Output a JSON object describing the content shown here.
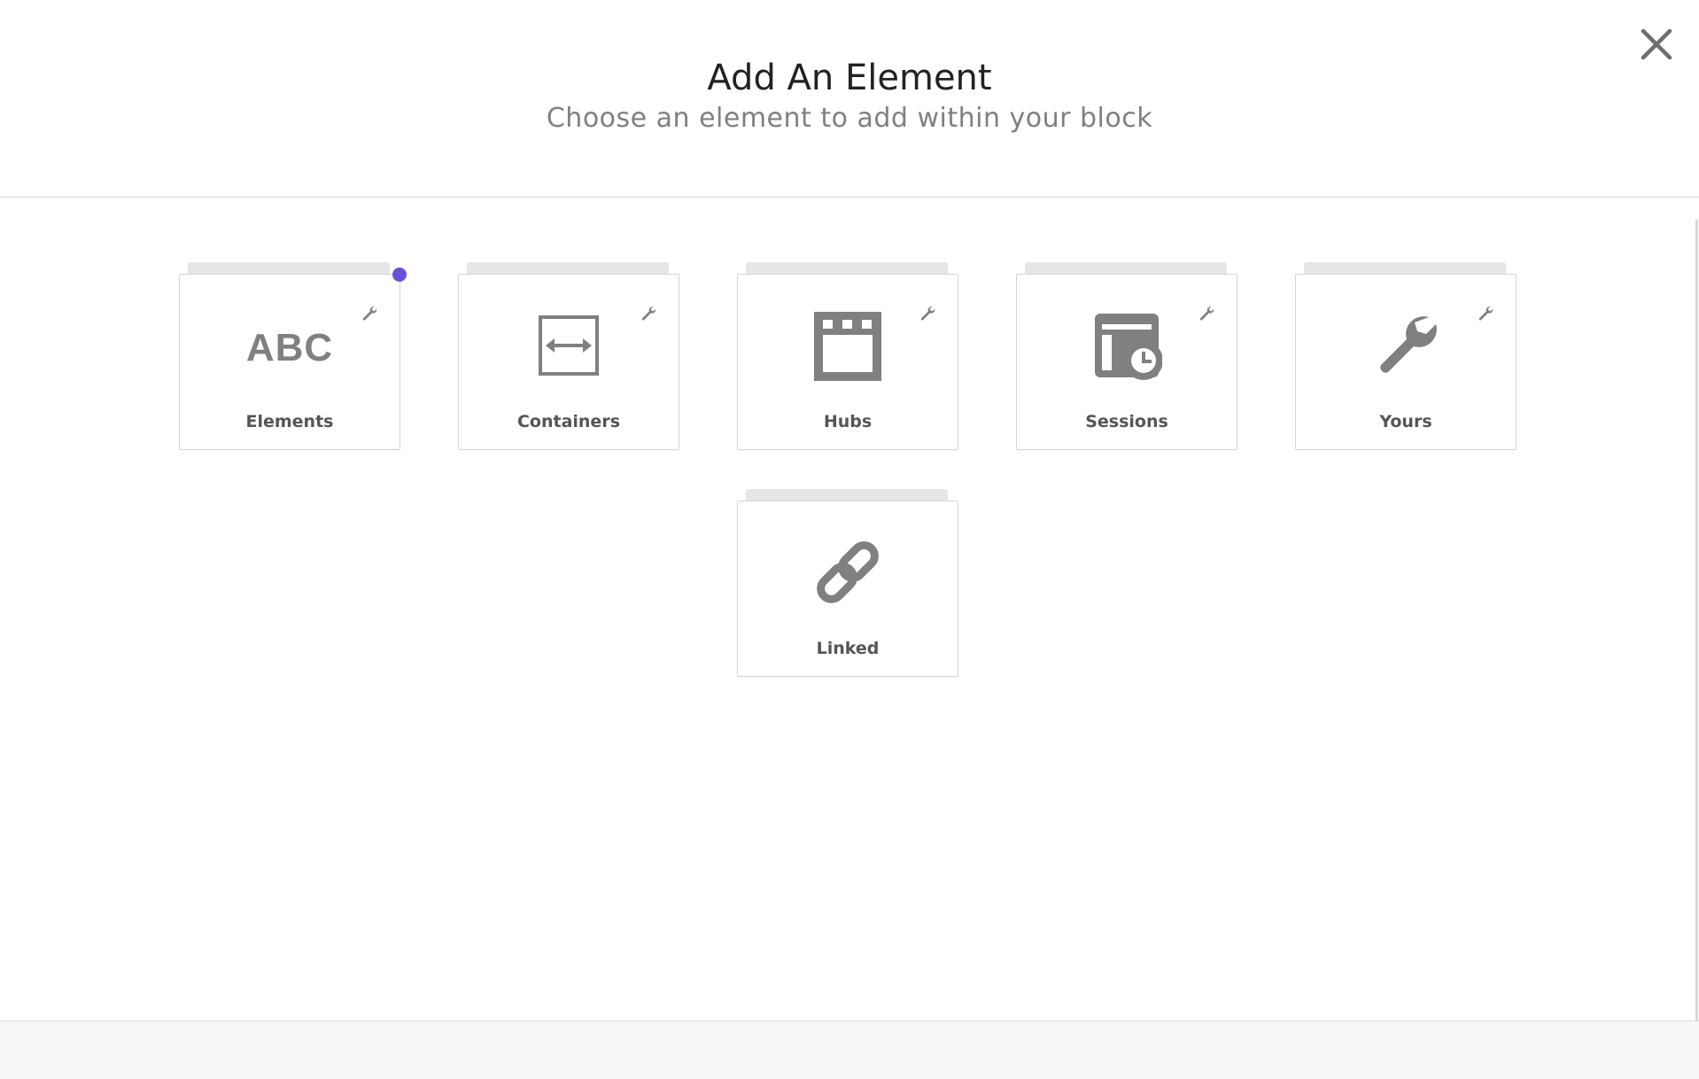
{
  "modal": {
    "title": "Add An Element",
    "subtitle": "Choose an element to add within your block"
  },
  "tiles": [
    {
      "label": "Elements",
      "icon": "abc-text-icon",
      "glyph": "ABC",
      "has_settings": true
    },
    {
      "label": "Containers",
      "icon": "container-arrows-icon",
      "has_settings": true
    },
    {
      "label": "Hubs",
      "icon": "hub-window-icon",
      "has_settings": true
    },
    {
      "label": "Sessions",
      "icon": "session-calendar-clock-icon",
      "has_settings": true
    },
    {
      "label": "Yours",
      "icon": "wrench-icon",
      "has_settings": true
    },
    {
      "label": "Linked",
      "icon": "link-chain-icon",
      "has_settings": false
    }
  ],
  "colors": {
    "icon": "#808080",
    "label": "#555555",
    "title": "#222222",
    "subtitle": "#808080",
    "notification_dot": "#6b4fd8",
    "tile_tab": "#e6e6e6",
    "border": "#d6d6d6"
  }
}
